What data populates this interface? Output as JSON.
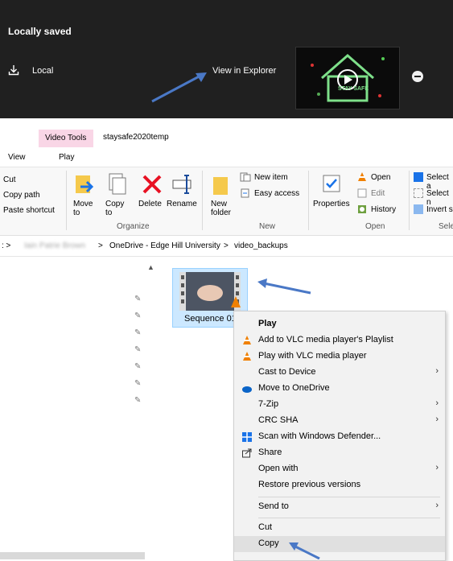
{
  "top_panel": {
    "status": "Locally saved",
    "location": "Local",
    "action": "View in Explorer",
    "thumb_text": "STAY SAFE",
    "remove_icon": "minus-circle-icon"
  },
  "window": {
    "context_tab": "Video Tools",
    "folder": "staysafe2020temp",
    "tabs": [
      "View",
      "Play"
    ]
  },
  "ribbon": {
    "clipboard": [
      "Cut",
      "Copy path",
      "Paste shortcut"
    ],
    "organize": {
      "move": "Move to",
      "copy": "Copy to",
      "delete": "Delete",
      "rename": "Rename",
      "label": "Organize"
    },
    "new": {
      "folder": "New folder",
      "new_item": "New item",
      "easy_access": "Easy access",
      "label": "New"
    },
    "open": {
      "properties": "Properties",
      "open": "Open",
      "edit": "Edit",
      "history": "History",
      "label": "Open"
    },
    "select": {
      "select_all": "Select a",
      "select_none": "Select n",
      "invert": "Invert s",
      "label": "Sele"
    }
  },
  "breadcrumb": {
    "user": "Iain Patrie Brown",
    "path1": "OneDrive - Edge Hill University",
    "path2": "video_backups"
  },
  "file": {
    "name": "Sequence 01"
  },
  "context_menu": {
    "items": [
      {
        "label": "Play",
        "bold": true
      },
      {
        "label": "Add to VLC media player's Playlist"
      },
      {
        "label": "Play with VLC media player"
      },
      {
        "label": "Cast to Device"
      },
      {
        "label": "Move to OneDrive"
      },
      {
        "label": "7-Zip"
      },
      {
        "label": "CRC SHA"
      },
      {
        "label": "Scan with Windows Defender..."
      },
      {
        "label": "Share"
      },
      {
        "label": "Open with"
      },
      {
        "label": "Restore previous versions"
      },
      {
        "label": "Send to"
      },
      {
        "label": "Cut"
      },
      {
        "label": "Copy"
      }
    ]
  },
  "colors": {
    "dark_panel": "#202020",
    "accent_pink": "#f9d6e6",
    "selection": "#cce8ff",
    "arrow_blue": "#4a78c6"
  }
}
